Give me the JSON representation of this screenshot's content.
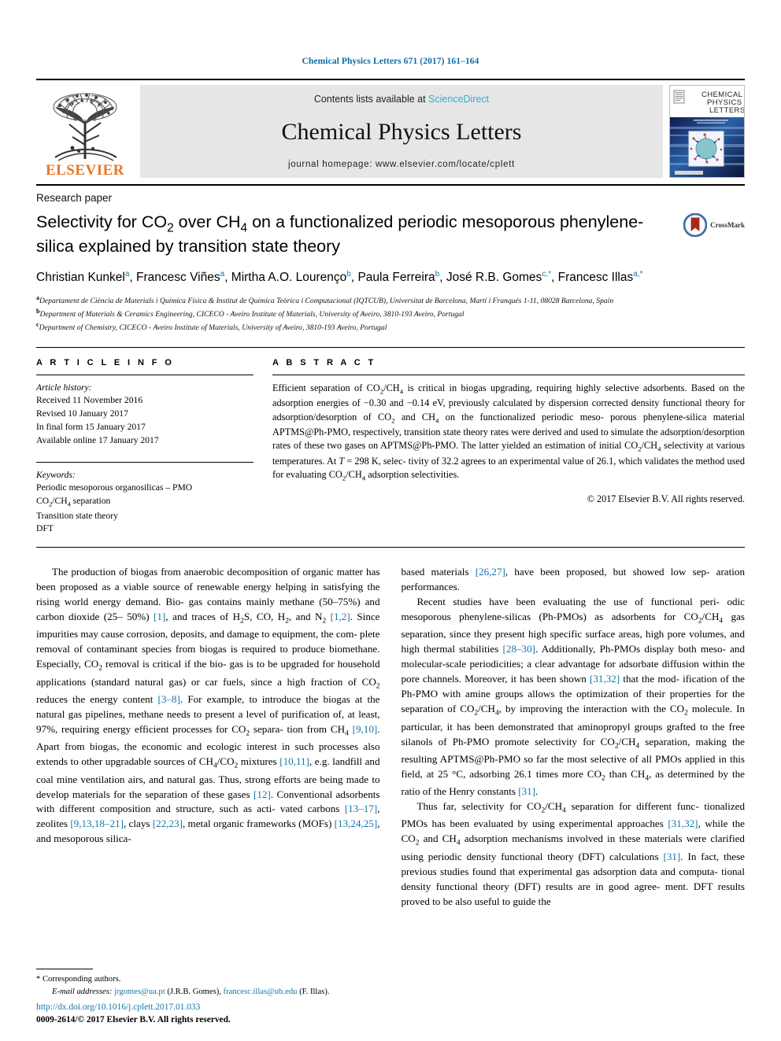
{
  "running_head": "Chemical Physics Letters 671 (2017) 161–164",
  "masthead": {
    "publisher": "ELSEVIER",
    "contents_prefix": "Contents lists available at ",
    "contents_link": "ScienceDirect",
    "journal_name": "Chemical Physics Letters",
    "homepage": "journal homepage: www.elsevier.com/locate/cplett",
    "cover": {
      "line1": "CHEMICAL",
      "line2": "PHYSICS",
      "line3": "LETTERS"
    }
  },
  "article": {
    "type": "Research paper",
    "title_line1_a": "Selectivity for CO",
    "title_line1_sub1": "2",
    "title_line1_b": " over CH",
    "title_line1_sub2": "4",
    "title_line1_c": " on a functionalized periodic mesoporous",
    "title_line2": "phenylene-silica explained by transition state theory",
    "crossmark_label": "CrossMark"
  },
  "authors": [
    {
      "name": "Christian Kunkel",
      "sup": "a",
      "sep": ", "
    },
    {
      "name": "Francesc Viñes",
      "sup": "a",
      "sep": ", "
    },
    {
      "name": "Mirtha A.O. Lourenço",
      "sup": "b",
      "sep": ", "
    },
    {
      "name": "Paula Ferreira",
      "sup": "b",
      "sep": ", "
    },
    {
      "name": "José R.B. Gomes",
      "sup": "c,*",
      "sep": ", "
    },
    {
      "name": "Francesc Illas",
      "sup": "a,*",
      "sep": ""
    }
  ],
  "affiliations": [
    {
      "marker": "a",
      "text": "Departament de Ciència de Materials i Química Física & Institut de Química Teòrica i Computacional (IQTCUB), Universitat de Barcelona, Martí i Franqués 1-11, 08028 Barcelona, Spain"
    },
    {
      "marker": "b",
      "text": "Department of Materials & Ceramics Engineering, CICECO - Aveiro Institute of Materials, University of Aveiro, 3810-193 Aveiro, Portugal"
    },
    {
      "marker": "c",
      "text": "Department of Chemistry, CICECO - Aveiro Institute of Materials, University of Aveiro, 3810-193 Aveiro, Portugal"
    }
  ],
  "article_info": {
    "heading": "A R T I C L E   I N F O",
    "history_label": "Article history:",
    "history": [
      "Received 11 November 2016",
      "Revised 10 January 2017",
      "In final form 15 January 2017",
      "Available online 17 January 2017"
    ],
    "keywords_label": "Keywords:",
    "keywords": [
      "Periodic mesoporous organosilicas – PMO",
      "CO2/CH4 separation",
      "Transition state theory",
      "DFT"
    ]
  },
  "abstract": {
    "heading": "A B S T R A C T",
    "text": "Efficient separation of CO2/CH4 is critical in biogas upgrading, requiring highly selective adsorbents. Based on the adsorption energies of −0.30 and −0.14 eV, previously calculated by dispersion corrected density functional theory for adsorption/desorption of CO2 and CH4 on the functionalized periodic mesoporous phenylene-silica material APTMS@Ph-PMO, respectively, transition state theory rates were derived and used to simulate the adsorption/desorption rates of these two gases on APTMS@Ph-PMO. The latter yielded an estimation of initial CO2/CH4 selectivity at various temperatures. At T = 298 K, selectivity of 32.2 agrees to an experimental value of 26.1, which validates the method used for evaluating CO2/CH4 adsorption selectivities.",
    "copyright": "© 2017 Elsevier B.V. All rights reserved."
  },
  "body": {
    "left": [
      "The production of biogas from anaerobic decomposition of organic matter has been proposed as a viable source of renewable energy helping in satisfying the rising world energy demand. Biogas contains mainly methane (50–75%) and carbon dioxide (25–50%) [1], and traces of H2S, CO, H2, and N2 [1,2]. Since impurities may cause corrosion, deposits, and damage to equipment, the complete removal of contaminant species from biogas is required to produce biomethane. Especially, CO2 removal is critical if the biogas is to be upgraded for household applications (standard natural gas) or car fuels, since a high fraction of CO2 reduces the energy content [3–8]. For example, to introduce the biogas at the natural gas pipelines, methane needs to present a level of purification of, at least, 97%, requiring energy efficient processes for CO2 separation from CH4 [9,10]. Apart from biogas, the economic and ecologic interest in such processes also extends to other upgradable sources of CH4/CO2 mixtures [10,11], e.g. landfill and coal mine ventilation airs, and natural gas. Thus, strong efforts are being made to develop materials for the separation of these gases [12]. Conventional adsorbents with different composition and structure, such as activated carbons [13–17], zeolites [9,13,18–21], clays [22,23], metal organic frameworks (MOFs) [13,24,25], and mesoporous silica-"
    ],
    "right": [
      "based materials [26,27], have been proposed, but showed low separation performances.",
      "Recent studies have been evaluating the use of functional periodic mesoporous phenylene-silicas (Ph-PMOs) as adsorbents for CO2/CH4 gas separation, since they present high specific surface areas, high pore volumes, and high thermal stabilities [28–30]. Additionally, Ph-PMOs display both meso- and molecular-scale periodicities; a clear advantage for adsorbate diffusion within the pore channels. Moreover, it has been shown [31,32] that the modification of the Ph-PMO with amine groups allows the optimization of their properties for the separation of CO2/CH4, by improving the interaction with the CO2 molecule. In particular, it has been demonstrated that aminopropyl groups grafted to the free silanols of Ph-PMO promote selectivity for CO2/CH4 separation, making the resulting APTMS@Ph-PMO so far the most selective of all PMOs applied in this field, at 25 °C, adsorbing 26.1 times more CO2 than CH4, as determined by the ratio of the Henry constants [31].",
      "Thus far, selectivity for CO2/CH4 separation for different functionalized PMOs has been evaluated by using experimental approaches [31,32], while the CO2 and CH4 adsorption mechanisms involved in these materials were clarified using periodic density functional theory (DFT) calculations [31]. In fact, these previous studies found that experimental gas adsorption data and computational density functional theory (DFT) results are in good agreement. DFT results proved to be also useful to guide the"
    ]
  },
  "footnote": {
    "marker": "*",
    "corresponding": "Corresponding authors.",
    "email_label": "E-mail addresses:",
    "email1": "jrgomes@ua.pt",
    "email1_owner": "(J.R.B. Gomes),",
    "email2": "francesc.illas@ub.edu",
    "email2_owner": "(F. Illas)."
  },
  "footer": {
    "doi": "http://dx.doi.org/10.1016/j.cplett.2017.01.033",
    "issn": "0009-2614/© 2017 Elsevier B.V. All rights reserved."
  },
  "colors": {
    "link": "#1277a8",
    "sciencedirect": "#3aa6d6",
    "elsevier_orange": "#E87722",
    "band_gray": "#e6e6e6"
  }
}
